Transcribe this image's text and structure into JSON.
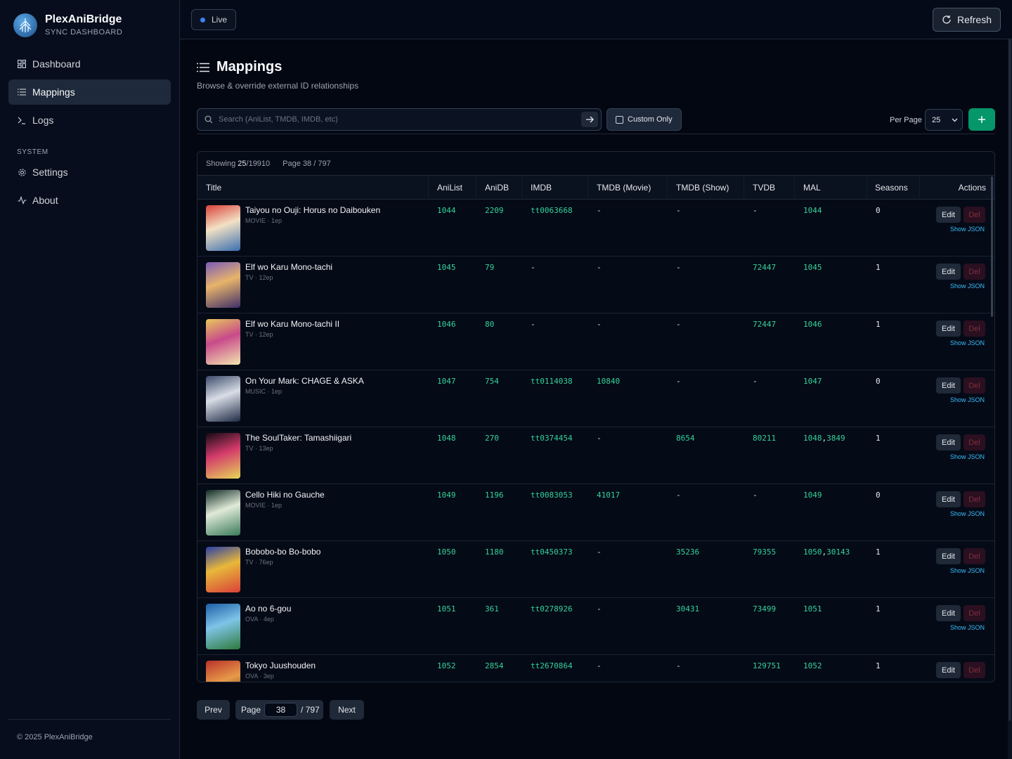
{
  "app": {
    "name": "PlexAniBridge",
    "subtitle": "SYNC DASHBOARD",
    "footer": "© 2025 PlexAniBridge"
  },
  "nav": {
    "items": [
      {
        "label": "Dashboard",
        "icon": "grid-icon"
      },
      {
        "label": "Mappings",
        "icon": "list-icon",
        "active": true
      },
      {
        "label": "Logs",
        "icon": "terminal-icon"
      }
    ],
    "section": "SYSTEM",
    "system_items": [
      {
        "label": "Settings",
        "icon": "gear-icon"
      },
      {
        "label": "About",
        "icon": "activity-icon"
      }
    ]
  },
  "topbar": {
    "live_label": "Live",
    "refresh_label": "Refresh"
  },
  "page": {
    "title": "Mappings",
    "subtitle": "Browse & override external ID relationships"
  },
  "toolbar": {
    "search_placeholder": "Search (AniList, TMDB, IMDB, etc)",
    "custom_only_label": "Custom Only",
    "per_page_label": "Per Page",
    "per_page_value": "25"
  },
  "table": {
    "showing_prefix": "Showing",
    "showing_count": "25",
    "showing_total": "/19910",
    "page_info": "Page 38 / 797",
    "columns": [
      "Title",
      "AniList",
      "AniDB",
      "IMDB",
      "TMDB (Movie)",
      "TMDB (Show)",
      "TVDB",
      "MAL",
      "Seasons",
      "Actions"
    ],
    "edit_label": "Edit",
    "del_label": "Del",
    "json_label": "Show JSON",
    "rows": [
      {
        "title": "Taiyou no Ouji: Horus no Daibouken",
        "meta": "MOVIE · 1ep",
        "anilist": "1044",
        "anidb": "2209",
        "imdb": "tt0063668",
        "tmdb_movie": "-",
        "tmdb_show": "-",
        "tvdb": "-",
        "mal": "1044",
        "mal2": "",
        "seasons": "0",
        "poster": [
          "#d9413a",
          "#f2e1c4",
          "#3a6fb0"
        ]
      },
      {
        "title": "Elf wo Karu Mono-tachi",
        "meta": "TV · 12ep",
        "anilist": "1045",
        "anidb": "79",
        "imdb": "-",
        "tmdb_movie": "-",
        "tmdb_show": "-",
        "tvdb": "72447",
        "mal": "1045",
        "mal2": "",
        "seasons": "1",
        "poster": [
          "#7a5bb8",
          "#e8b46a",
          "#3f2f68"
        ]
      },
      {
        "title": "Elf wo Karu Mono-tachi II",
        "meta": "TV · 12ep",
        "anilist": "1046",
        "anidb": "80",
        "imdb": "-",
        "tmdb_movie": "-",
        "tmdb_show": "-",
        "tvdb": "72447",
        "mal": "1046",
        "mal2": "",
        "seasons": "1",
        "poster": [
          "#e8c85a",
          "#c84a8a",
          "#f4e7b0"
        ]
      },
      {
        "title": "On Your Mark: CHAGE & ASKA",
        "meta": "MUSIC · 1ep",
        "anilist": "1047",
        "anidb": "754",
        "imdb": "tt0114038",
        "tmdb_movie": "10840",
        "tmdb_show": "-",
        "tvdb": "-",
        "mal": "1047",
        "mal2": "",
        "seasons": "0",
        "poster": [
          "#3c4a6a",
          "#d8dde6",
          "#1e2a44"
        ]
      },
      {
        "title": "The SoulTaker: Tamashiigari",
        "meta": "TV · 13ep",
        "anilist": "1048",
        "anidb": "270",
        "imdb": "tt0374454",
        "tmdb_movie": "-",
        "tmdb_show": "8654",
        "tvdb": "80211",
        "mal": "1048",
        "mal2": "3849",
        "seasons": "1",
        "poster": [
          "#120a14",
          "#d23a6a",
          "#e8d65a"
        ]
      },
      {
        "title": "Cello Hiki no Gauche",
        "meta": "MOVIE · 1ep",
        "anilist": "1049",
        "anidb": "1196",
        "imdb": "tt0083053",
        "tmdb_movie": "41017",
        "tmdb_show": "-",
        "tvdb": "-",
        "mal": "1049",
        "mal2": "",
        "seasons": "0",
        "poster": [
          "#0f2a24",
          "#e0ead8",
          "#3a7a5a"
        ]
      },
      {
        "title": "Bobobo-bo Bo-bobo",
        "meta": "TV · 76ep",
        "anilist": "1050",
        "anidb": "1180",
        "imdb": "tt0450373",
        "tmdb_movie": "-",
        "tmdb_show": "35236",
        "tvdb": "79355",
        "mal": "1050",
        "mal2": "30143",
        "seasons": "1",
        "poster": [
          "#2a3fa8",
          "#e8b83a",
          "#d9413a"
        ]
      },
      {
        "title": "Ao no 6-gou",
        "meta": "OVA · 4ep",
        "anilist": "1051",
        "anidb": "361",
        "imdb": "tt0278926",
        "tmdb_movie": "-",
        "tmdb_show": "30431",
        "tvdb": "73499",
        "mal": "1051",
        "mal2": "",
        "seasons": "1",
        "poster": [
          "#1b5fa8",
          "#7fc4e8",
          "#2e7a3c"
        ]
      },
      {
        "title": "Tokyo Juushouden",
        "meta": "OVA · 3ep",
        "anilist": "1052",
        "anidb": "2854",
        "imdb": "tt2670864",
        "tmdb_movie": "-",
        "tmdb_show": "-",
        "tvdb": "129751",
        "mal": "1052",
        "mal2": "",
        "seasons": "1",
        "poster": [
          "#b8322a",
          "#e89a4a",
          "#3a1a14"
        ]
      }
    ]
  },
  "pager": {
    "prev_label": "Prev",
    "page_label": "Page",
    "page_value": "38",
    "page_total": "/ 797",
    "next_label": "Next"
  }
}
